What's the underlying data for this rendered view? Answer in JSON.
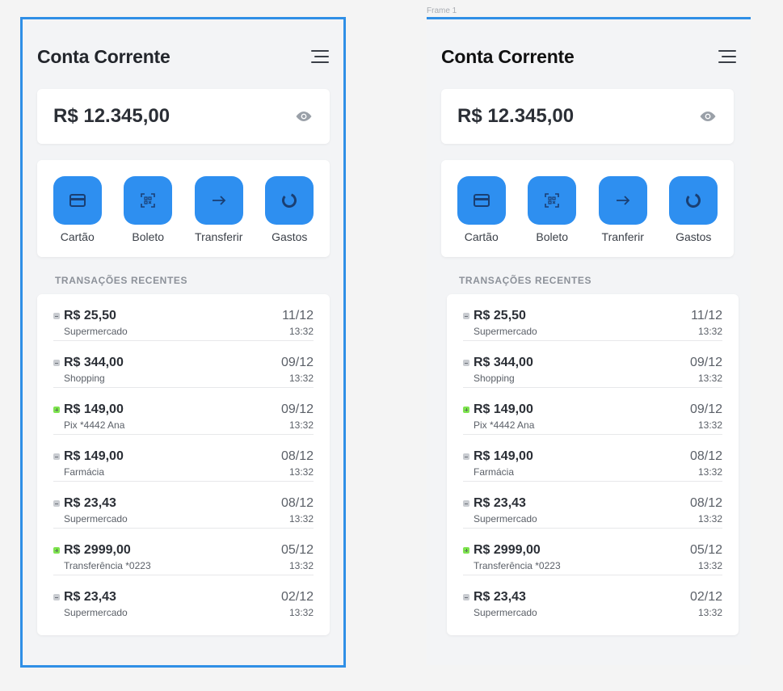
{
  "frame_label": "Frame 1",
  "screens": [
    {
      "title": "Conta Corrente",
      "balance": "R$ 12.345,00",
      "actions": [
        "Cartão",
        "Boleto",
        "Transferir",
        "Gastos"
      ],
      "section_title": "TRANSAÇÕES RECENTES",
      "transactions": [
        {
          "type": "debit",
          "amount": "R$ 25,50",
          "desc": "Supermercado",
          "date": "11/12",
          "time": "13:32"
        },
        {
          "type": "debit",
          "amount": "R$ 344,00",
          "desc": "Shopping",
          "date": "09/12",
          "time": "13:32"
        },
        {
          "type": "credit",
          "amount": "R$ 149,00",
          "desc": "Pix *4442 Ana",
          "date": "09/12",
          "time": "13:32"
        },
        {
          "type": "debit",
          "amount": "R$ 149,00",
          "desc": "Farmácia",
          "date": "08/12",
          "time": "13:32"
        },
        {
          "type": "debit",
          "amount": "R$ 23,43",
          "desc": "Supermercado",
          "date": "08/12",
          "time": "13:32"
        },
        {
          "type": "credit",
          "amount": "R$ 2999,00",
          "desc": "Transferência *0223",
          "date": "05/12",
          "time": "13:32"
        },
        {
          "type": "debit",
          "amount": "R$ 23,43",
          "desc": "Supermercado",
          "date": "02/12",
          "time": "13:32"
        }
      ]
    },
    {
      "title": "Conta Corrente",
      "balance": "R$ 12.345,00",
      "actions": [
        "Cartão",
        "Boleto",
        "Tranferir",
        "Gastos"
      ],
      "section_title": "TRANSAÇÕES RECENTES",
      "transactions": [
        {
          "type": "debit",
          "amount": "R$ 25,50",
          "desc": "Supermercado",
          "date": "11/12",
          "time": "13:32"
        },
        {
          "type": "debit",
          "amount": "R$ 344,00",
          "desc": "Shopping",
          "date": "09/12",
          "time": "13:32"
        },
        {
          "type": "credit",
          "amount": "R$ 149,00",
          "desc": "Pix *4442 Ana",
          "date": "09/12",
          "time": "13:32"
        },
        {
          "type": "debit",
          "amount": "R$ 149,00",
          "desc": "Farmácia",
          "date": "08/12",
          "time": "13:32"
        },
        {
          "type": "debit",
          "amount": "R$ 23,43",
          "desc": "Supermercado",
          "date": "08/12",
          "time": "13:32"
        },
        {
          "type": "credit",
          "amount": "R$ 2999,00",
          "desc": "Transferência *0223",
          "date": "05/12",
          "time": "13:32"
        },
        {
          "type": "debit",
          "amount": "R$ 23,43",
          "desc": "Supermercado",
          "date": "02/12",
          "time": "13:32"
        }
      ]
    }
  ],
  "action_icons": [
    "card-icon",
    "barcode-icon",
    "arrow-right-icon",
    "donut-chart-icon"
  ],
  "colors": {
    "accent": "#2e8ff0",
    "frame_border": "#2f8fe6",
    "credit": "#7ee34f",
    "debit": "#c9ccd1"
  }
}
